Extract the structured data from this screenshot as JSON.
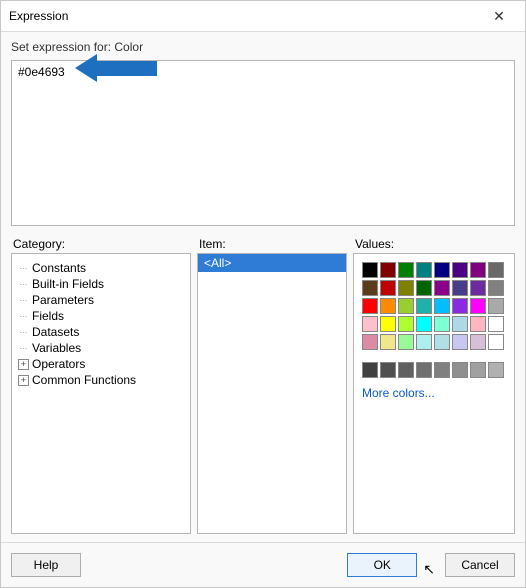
{
  "window": {
    "title": "Expression"
  },
  "prompt": "Set expression for: Color",
  "expression_value": "#0e4693",
  "panels": {
    "category_label": "Category:",
    "item_label": "Item:",
    "values_label": "Values:"
  },
  "category_tree": [
    {
      "label": "Constants",
      "toggle": "dots"
    },
    {
      "label": "Built-in Fields",
      "toggle": "dots"
    },
    {
      "label": "Parameters",
      "toggle": "dots"
    },
    {
      "label": "Fields",
      "toggle": "dots"
    },
    {
      "label": "Datasets",
      "toggle": "dots"
    },
    {
      "label": "Variables",
      "toggle": "dots"
    },
    {
      "label": "Operators",
      "toggle": "plus"
    },
    {
      "label": "Common Functions",
      "toggle": "plus"
    }
  ],
  "items": [
    {
      "label": "<All>",
      "selected": true
    }
  ],
  "color_swatches": [
    "#000000",
    "#800000",
    "#008000",
    "#008080",
    "#000080",
    "#4b0082",
    "#800080",
    "#696969",
    "#5a3b1c",
    "#c00000",
    "#808000",
    "#006400",
    "#8b008b",
    "#483d8b",
    "#6a2ca0",
    "#808080",
    "#ff0000",
    "#ff8c00",
    "#9acd32",
    "#20b2aa",
    "#00bfff",
    "#8a2be2",
    "#ff00ff",
    "#a9a9a9",
    "#ffc0cb",
    "#ffff00",
    "#adff2f",
    "#00ffff",
    "#7fffd4",
    "#add8e6",
    "#ffb6c1",
    "#ffffff",
    "#de8aa7",
    "#f0e68c",
    "#98fb98",
    "#afeeee",
    "#b0e0e6",
    "#c7c7f2",
    "#d8bfd8",
    "#ffffff"
  ],
  "grey_row": [
    "#404040",
    "#505050",
    "#606060",
    "#707070",
    "#808080",
    "#909090",
    "#a0a0a0",
    "#b0b0b0"
  ],
  "more_colors_label": "More colors...",
  "buttons": {
    "help": "Help",
    "ok": "OK",
    "cancel": "Cancel"
  }
}
